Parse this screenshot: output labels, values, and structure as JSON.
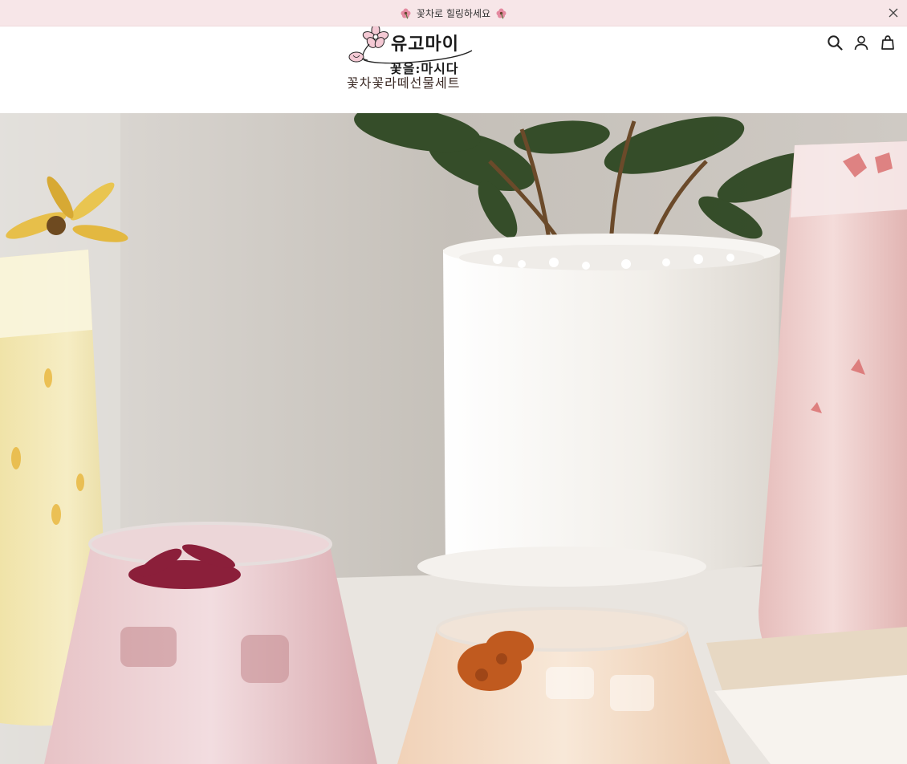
{
  "announcement": {
    "text": "꽃차로 힐링하세요",
    "left_icon": "flower-icon",
    "right_icon": "flower-icon",
    "close_icon": "close-icon",
    "background": "#f7e6e8"
  },
  "header": {
    "logo": {
      "line1": "유고마이",
      "line2": "꽃을:마시다",
      "line3": "꽃차꽃라떼선물세트"
    },
    "icons": [
      "search-icon",
      "account-icon",
      "cart-icon"
    ]
  },
  "hero": {
    "image_alt": "",
    "colors": {
      "pink_drink": "#f2d3d3",
      "yellow_drink": "#f3e8b4",
      "peach_drink": "#f4dcc8",
      "leaf": "#2f4a23",
      "pot": "#f6f3ef"
    }
  }
}
